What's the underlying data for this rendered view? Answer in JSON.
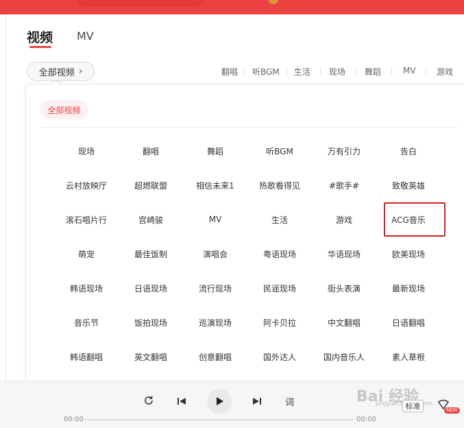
{
  "tabs": {
    "video": "视频",
    "mv": "MV"
  },
  "all_videos_button": {
    "label": "全部视频",
    "chevron": "›"
  },
  "quick_categories": [
    "翻唱",
    "听BGM",
    "生活",
    "现场",
    "舞蹈",
    "MV",
    "游戏"
  ],
  "panel": {
    "chip_label": "全部视频",
    "rows": [
      [
        "现场",
        "翻唱",
        "舞蹈",
        "听BGM",
        "万有引力",
        "告白"
      ],
      [
        "云村放映厅",
        "超燃联盟",
        "相信未来1",
        "热歌看得见",
        "#歌手#",
        "致敬英雄"
      ],
      [
        "滚石唱片行",
        "宫崎骏",
        "MV",
        "生活",
        "游戏",
        "ACG音乐"
      ],
      [
        "萌宠",
        "最佳饭制",
        "演唱会",
        "粤语现场",
        "华语现场",
        "欧美现场"
      ],
      [
        "韩语现场",
        "日语现场",
        "流行现场",
        "民谣现场",
        "街头表演",
        "最新现场"
      ],
      [
        "音乐节",
        "饭拍现场",
        "巡演现场",
        "阿卡贝拉",
        "中文翻唱",
        "日语翻唱"
      ],
      [
        "韩语翻唱",
        "英文翻唱",
        "创意翻唱",
        "国外达人",
        "国内音乐人",
        "素人草根"
      ]
    ],
    "highlighted_item": "ACG音乐"
  },
  "player": {
    "time_current": "00:00",
    "time_total": "00:00",
    "progress": 0,
    "lyrics_label": "词",
    "quality_label": "标准",
    "new_badge": "NEW",
    "icons": [
      "loop-icon",
      "previous-icon",
      "play-icon",
      "next-icon",
      "lyrics-icon"
    ]
  },
  "watermark": {
    "text": "Bai 经验",
    "sub": "jingyan.baidu.com"
  },
  "colors": {
    "brand_red": "#ec4141",
    "highlight_red": "#d42020",
    "chip_bg": "#fdf0f0"
  }
}
